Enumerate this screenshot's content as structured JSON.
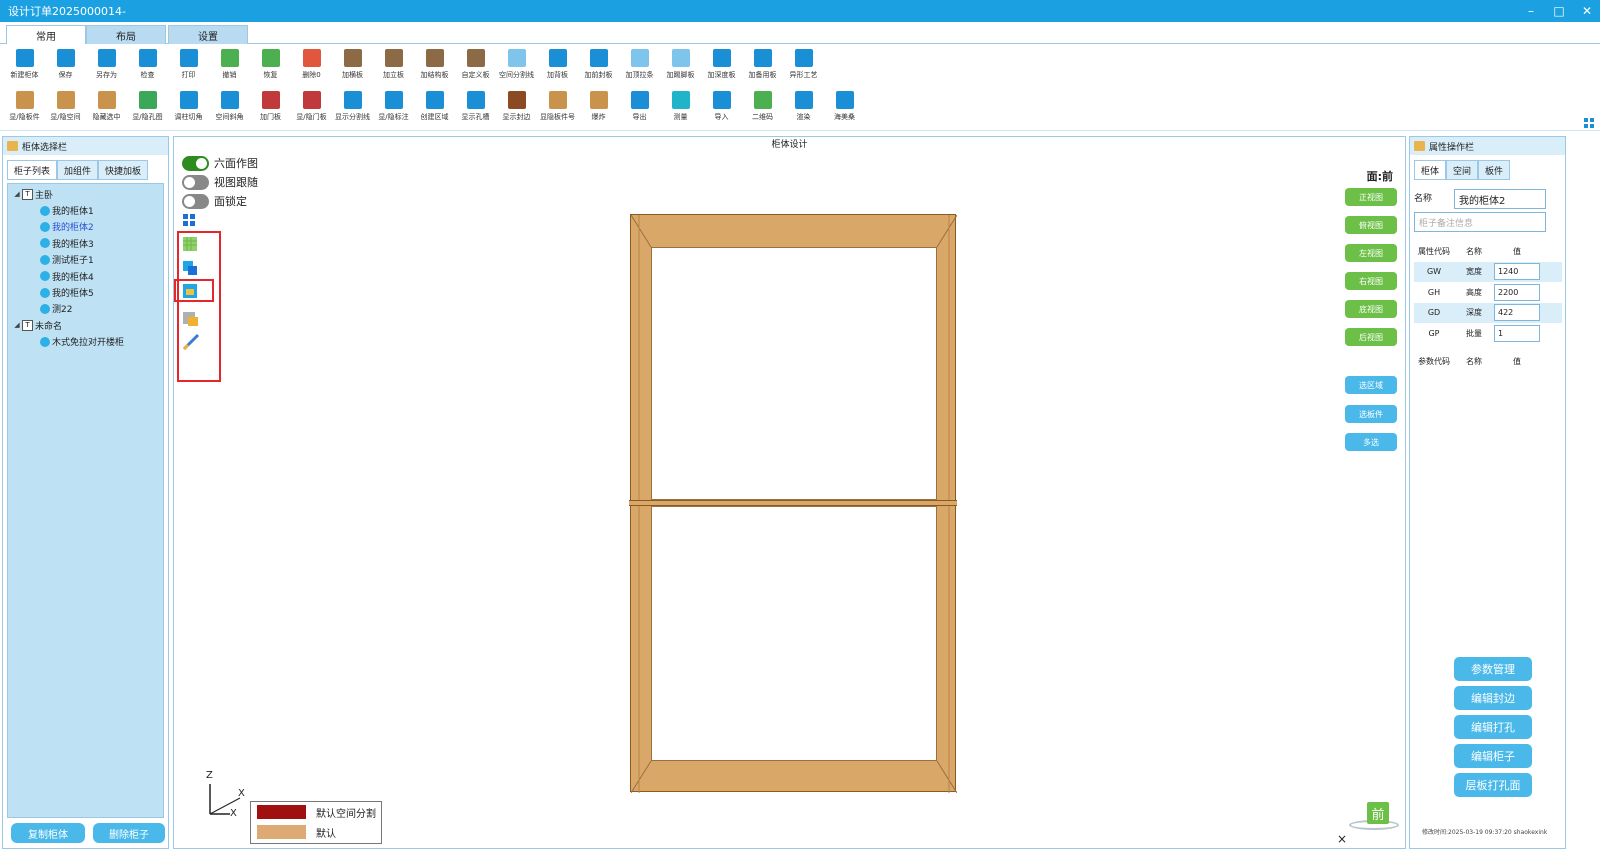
{
  "window": {
    "title": "设计订单2025000014-"
  },
  "ribbon_tabs": [
    "常用",
    "布局",
    "设置"
  ],
  "toolbar_row1": [
    {
      "label": "新建柜体",
      "icon": "new-cabinet-icon",
      "color": "#1b8fd6"
    },
    {
      "label": "保存",
      "icon": "save-icon",
      "color": "#1b8fd6"
    },
    {
      "label": "另存为",
      "icon": "save-as-icon",
      "color": "#1b8fd6"
    },
    {
      "label": "检查",
      "icon": "check-icon",
      "color": "#1b8fd6"
    },
    {
      "label": "打印",
      "icon": "print-icon",
      "color": "#1b8fd6"
    },
    {
      "label": "撤销",
      "icon": "undo-icon",
      "color": "#4caf50"
    },
    {
      "label": "恢复",
      "icon": "redo-icon",
      "color": "#4caf50"
    },
    {
      "label": "删除0",
      "icon": "delete-icon",
      "color": "#e0573e"
    },
    {
      "label": "加横板",
      "icon": "add-horizontal-board-icon",
      "color": "#8b6a45"
    },
    {
      "label": "加立板",
      "icon": "add-vertical-board-icon",
      "color": "#8b6a45"
    },
    {
      "label": "加结构板",
      "icon": "add-structure-board-icon",
      "color": "#8b6a45"
    },
    {
      "label": "自定义板",
      "icon": "custom-board-icon",
      "color": "#8b6a45"
    },
    {
      "label": "空间分割线",
      "icon": "space-divider-icon",
      "color": "#7fc4ea"
    },
    {
      "label": "加背板",
      "icon": "add-back-board-icon",
      "color": "#1b8fd6"
    },
    {
      "label": "加前封板",
      "icon": "add-front-panel-icon",
      "color": "#1b8fd6"
    },
    {
      "label": "加顶拉条",
      "icon": "add-top-strip-icon",
      "color": "#7fc4ea"
    },
    {
      "label": "加踢脚板",
      "icon": "add-kickboard-icon",
      "color": "#7fc4ea"
    },
    {
      "label": "加深度板",
      "icon": "add-depth-board-icon",
      "color": "#1b8fd6"
    },
    {
      "label": "加备用板",
      "icon": "add-spare-board-icon",
      "color": "#1b8fd6"
    },
    {
      "label": "异形工艺",
      "icon": "special-shape-icon",
      "color": "#1b8fd6"
    }
  ],
  "toolbar_row2": [
    {
      "label": "显/隐板件",
      "icon": "toggle-boards-icon",
      "color": "#c9924d"
    },
    {
      "label": "显/隐空间",
      "icon": "toggle-space-icon",
      "color": "#c9924d"
    },
    {
      "label": "隐藏选中",
      "icon": "hide-selected-icon",
      "color": "#c9924d"
    },
    {
      "label": "显/隐孔图",
      "icon": "toggle-hole-map-icon",
      "color": "#3aa858"
    },
    {
      "label": "调柱切角",
      "icon": "column-corner-icon",
      "color": "#1b8fd6"
    },
    {
      "label": "空间斜角",
      "icon": "space-bevel-icon",
      "color": "#1b8fd6"
    },
    {
      "label": "加门板",
      "icon": "add-door-icon",
      "color": "#c0393b"
    },
    {
      "label": "显/隐门板",
      "icon": "toggle-door-icon",
      "color": "#c0393b"
    },
    {
      "label": "显示分割线",
      "icon": "show-divider-icon",
      "color": "#1b8fd6"
    },
    {
      "label": "显/隐标注",
      "icon": "toggle-dimension-icon",
      "color": "#1b8fd6"
    },
    {
      "label": "创建区域",
      "icon": "create-region-icon",
      "color": "#1b8fd6"
    },
    {
      "label": "显示孔槽",
      "icon": "show-holes-icon",
      "color": "#1b8fd6"
    },
    {
      "label": "显示封边",
      "icon": "show-edge-banding-icon",
      "color": "#8b4a22"
    },
    {
      "label": "显隐板件号",
      "icon": "toggle-board-number-icon",
      "color": "#c9924d"
    },
    {
      "label": "爆炸",
      "icon": "explode-icon",
      "color": "#c9924d"
    },
    {
      "label": "导出",
      "icon": "export-icon",
      "color": "#1b8fd6"
    },
    {
      "label": "测量",
      "icon": "measure-icon",
      "color": "#1fb4c9"
    },
    {
      "label": "导入",
      "icon": "import-icon",
      "color": "#1b8fd6"
    },
    {
      "label": "二维码",
      "icon": "qr-code-icon",
      "color": "#4caf50"
    },
    {
      "label": "渲染",
      "icon": "render-icon",
      "color": "#1b8fd6"
    },
    {
      "label": "海美桑",
      "icon": "haimeisang-icon",
      "color": "#1b8fd6"
    }
  ],
  "left_panel": {
    "title": "柜体选择栏",
    "tabs": [
      "柜子列表",
      "加组件",
      "快捷加板"
    ],
    "tree": [
      {
        "label": "主卧",
        "level": 0,
        "group": true
      },
      {
        "label": "我的柜体1",
        "level": 1
      },
      {
        "label": "我的柜体2",
        "level": 1,
        "selected": true
      },
      {
        "label": "我的柜体3",
        "level": 1
      },
      {
        "label": "测试柜子1",
        "level": 1
      },
      {
        "label": "我的柜体4",
        "level": 1
      },
      {
        "label": "我的柜体5",
        "level": 1
      },
      {
        "label": "测22",
        "level": 1
      },
      {
        "label": "未命名",
        "level": 0,
        "group": true
      },
      {
        "label": "木式免拉对开楼柜",
        "level": 1
      }
    ],
    "copy_button": "复制柜体",
    "delete_button": "删除柜子"
  },
  "center": {
    "title": "柜体设计",
    "toggles": [
      {
        "label": "六面作图",
        "on": true
      },
      {
        "label": "视图跟随",
        "on": false
      },
      {
        "label": "面锁定",
        "on": false
      }
    ],
    "face_label": "面:前",
    "view_buttons": [
      "正视图",
      "俯视图",
      "左视图",
      "右视图",
      "底视图",
      "后视图"
    ],
    "select_buttons": [
      "选区域",
      "选板件",
      "多选"
    ],
    "axis": {
      "z": "Z",
      "x": "X",
      "y": "X"
    },
    "legend": [
      {
        "label": "默认空间分割",
        "color": "#a01010"
      },
      {
        "label": "默认",
        "color": "#dcaa72"
      }
    ],
    "front_label": "前",
    "close": "×",
    "colors": {
      "wood": "#d9a868",
      "wood_edge": "#8a5a22"
    }
  },
  "right_panel": {
    "title": "属性操作栏",
    "tabs": [
      "柜体",
      "空间",
      "板件"
    ],
    "name_label": "名称",
    "name_value": "我的柜体2",
    "note_placeholder": "柜子备注信息",
    "attr_headers": [
      "属性代码",
      "名称",
      "值"
    ],
    "attrs": [
      {
        "code": "GW",
        "name": "宽度",
        "value": "1240"
      },
      {
        "code": "GH",
        "name": "高度",
        "value": "2200"
      },
      {
        "code": "GD",
        "name": "深度",
        "value": "422"
      },
      {
        "code": "GP",
        "name": "批量",
        "value": "1"
      }
    ],
    "param_headers": [
      "参数代码",
      "名称",
      "值"
    ],
    "action_buttons": [
      "参数管理",
      "编辑封边",
      "编辑打孔",
      "编辑柜子",
      "层板打孔面"
    ],
    "footer": "修改时间:2025-03-19 09:37:20 shaokexink"
  },
  "window_controls": {
    "minimize": "–",
    "maximize": "□",
    "close": "✕"
  }
}
